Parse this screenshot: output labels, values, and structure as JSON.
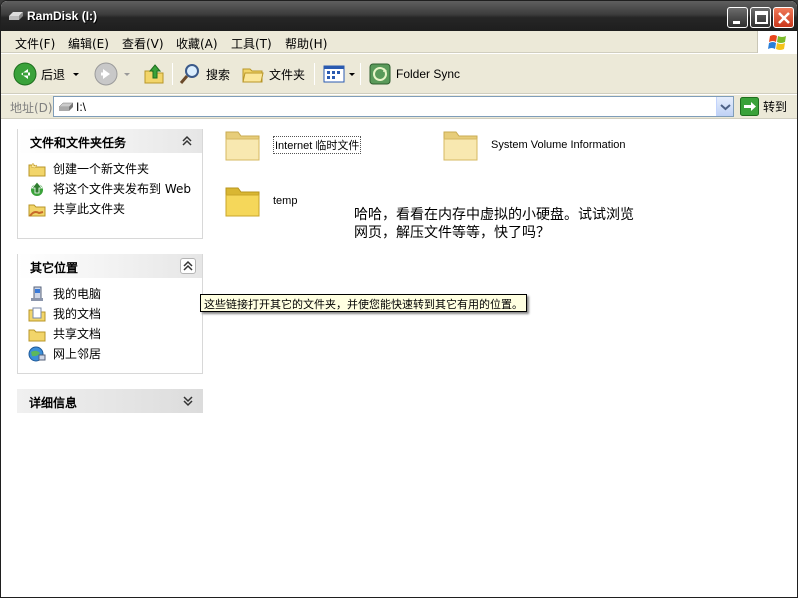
{
  "window": {
    "title": "RamDisk (I:)"
  },
  "menu": [
    "文件(F)",
    "编辑(E)",
    "查看(V)",
    "收藏(A)",
    "工具(T)",
    "帮助(H)"
  ],
  "toolbar": {
    "back_label": "后退",
    "search_label": "搜索",
    "folders_label": "文件夹",
    "folder_sync_label": "Folder Sync"
  },
  "address": {
    "label": "地址(D)",
    "value": "I:\\",
    "go_label": "转到"
  },
  "tasks_panel": {
    "title": "文件和文件夹任务",
    "items": [
      "创建一个新文件夹",
      "将这个文件夹发布到 Web",
      "共享此文件夹"
    ]
  },
  "other_places_panel": {
    "title": "其它位置",
    "items": [
      "我的电脑",
      "我的文档",
      "共享文档",
      "网上邻居"
    ]
  },
  "details_panel": {
    "title": "详细信息"
  },
  "folders": [
    "Internet 临时文件",
    "System Volume Information",
    "temp"
  ],
  "note": "哈哈，看看在内存中虚拟的小硬盘。试试浏览网页，解压文件等等，快了吗？",
  "tooltip": "这些链接打开其它的文件夹，并使您能快速转到其它有用的位置。"
}
